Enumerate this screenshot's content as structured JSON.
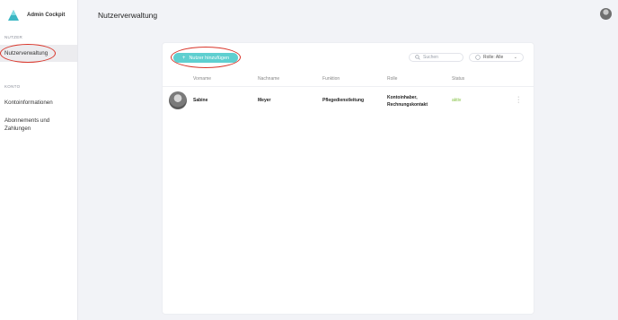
{
  "app": {
    "title": "Admin Cockpit"
  },
  "sidebar": {
    "section_user": "NUTZER",
    "item_users": "Nutzerverwaltung",
    "section_account": "KONTO",
    "item_account_info": "Kontoinformationen",
    "item_subscriptions_line1": "Abonnements und",
    "item_subscriptions_line2": "Zahlungen"
  },
  "header": {
    "title": "Nutzerverwaltung"
  },
  "toolbar": {
    "add_button": "Nutzer hinzufügen",
    "search_placeholder": "Suchen",
    "role_filter": "Rolle: Alle"
  },
  "table": {
    "columns": [
      "Vorname",
      "Nachname",
      "Funktion",
      "Rolle",
      "Status"
    ],
    "rows": [
      {
        "first_name": "Sabine",
        "last_name": "Meyer",
        "function": "Pflegedienstleitung",
        "role_line1": "Kontoinhaber,",
        "role_line2": "Rechnungskontakt",
        "status": "aktiv"
      }
    ]
  },
  "colors": {
    "accent": "#5fcfd0",
    "status_active": "#7fbf3c",
    "annotation": "#d9352a"
  }
}
